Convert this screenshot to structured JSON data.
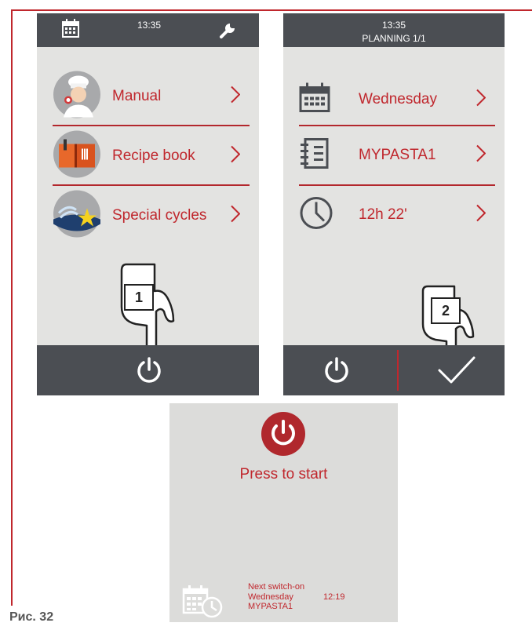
{
  "figure_label": "Рис. 32",
  "screen1": {
    "time": "13:35",
    "items": [
      {
        "label": "Manual",
        "icon": "chef-icon"
      },
      {
        "label": "Recipe book",
        "icon": "recipe-book-icon"
      },
      {
        "label": "Special cycles",
        "icon": "special-cycles-icon"
      }
    ],
    "step": "1"
  },
  "screen2": {
    "time": "13:35",
    "subtitle": "PLANNING 1/1",
    "items": [
      {
        "label": "Wednesday",
        "icon": "calendar-icon"
      },
      {
        "label": "MYPASTA1",
        "icon": "recipe-list-icon"
      },
      {
        "label": "12h 22'",
        "icon": "clock-icon"
      }
    ],
    "step": "2"
  },
  "screen3": {
    "press_label": "Press to start",
    "next_title": "Next switch-on",
    "next_day": "Wednesday",
    "next_time": "12:19",
    "next_recipe": "MYPASTA1"
  },
  "colors": {
    "accent": "#c0272d",
    "bar": "#4b4e53",
    "screen_bg": "#e3e3e1"
  }
}
